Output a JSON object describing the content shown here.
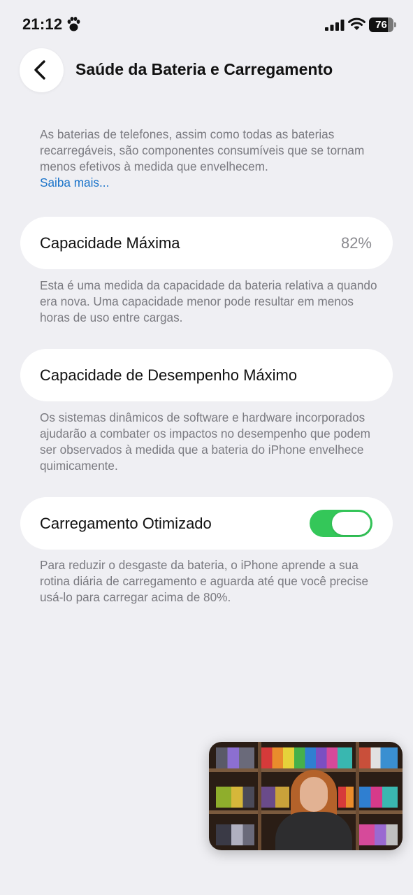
{
  "status_bar": {
    "time": "21:12",
    "battery_level": "76",
    "battery_fraction": 0.76,
    "icons": [
      "paw-icon",
      "signal-icon",
      "wifi-icon",
      "battery-icon"
    ]
  },
  "nav": {
    "back_icon": "chevron-left-icon",
    "title": "Saúde da Bateria e Carregamento"
  },
  "intro": {
    "text": "As baterias de telefones, assim como todas as baterias recarregáveis, são componentes consumíveis que se tornam menos efetivos à medida que envelhecem.",
    "link": "Saiba mais..."
  },
  "max_capacity": {
    "label": "Capacidade Máxima",
    "value": "82%",
    "description": "Esta é uma medida da capacidade da bateria relativa a quando era nova. Uma capacidade menor pode resultar em menos horas de uso entre cargas."
  },
  "peak_performance": {
    "label": "Capacidade de Desempenho Máximo",
    "description": "Os sistemas dinâmicos de software e hardware incorporados ajudarão a combater os impactos no desempenho que podem ser observados à medida que a bateria do iPhone envelhece quimicamente."
  },
  "optimized_charging": {
    "label": "Carregamento Otimizado",
    "enabled": true,
    "description": "Para reduzir o desgaste da bateria, o iPhone aprende a sua rotina diária de carregamento e aguarda até que você precise usá-lo para carregar acima de 80%."
  },
  "colors": {
    "background": "#efeff3",
    "accent_link": "#1a73c9",
    "toggle_on": "#34c759"
  }
}
